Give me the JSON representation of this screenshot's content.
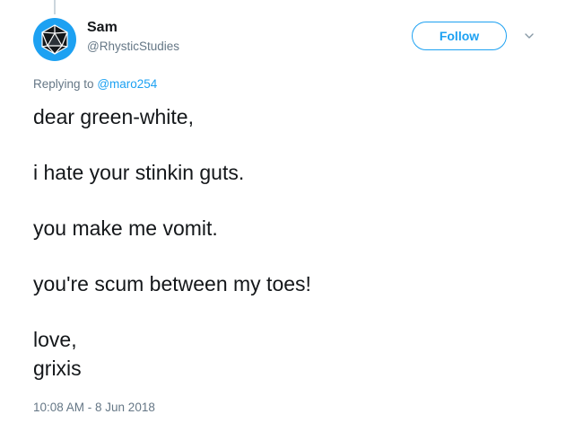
{
  "tweet": {
    "author": {
      "name": "Sam",
      "handle": "@RhysticStudies",
      "avatar_icon": "d20-die-icon",
      "avatar_color": "#1da1f2"
    },
    "follow_label": "Follow",
    "menu_icon": "chevron-down-icon",
    "replying_to": {
      "prefix": "Replying to",
      "mention": "@maro254"
    },
    "lines": [
      "dear green-white,",
      "i hate your stinkin guts.",
      "you make me vomit.",
      "you're scum between my toes!",
      "love,",
      "grixis"
    ],
    "timestamp": "10:08 AM - 8 Jun 2018"
  },
  "colors": {
    "accent": "#1da1f2",
    "text_primary": "#14171a",
    "text_secondary": "#657786"
  }
}
